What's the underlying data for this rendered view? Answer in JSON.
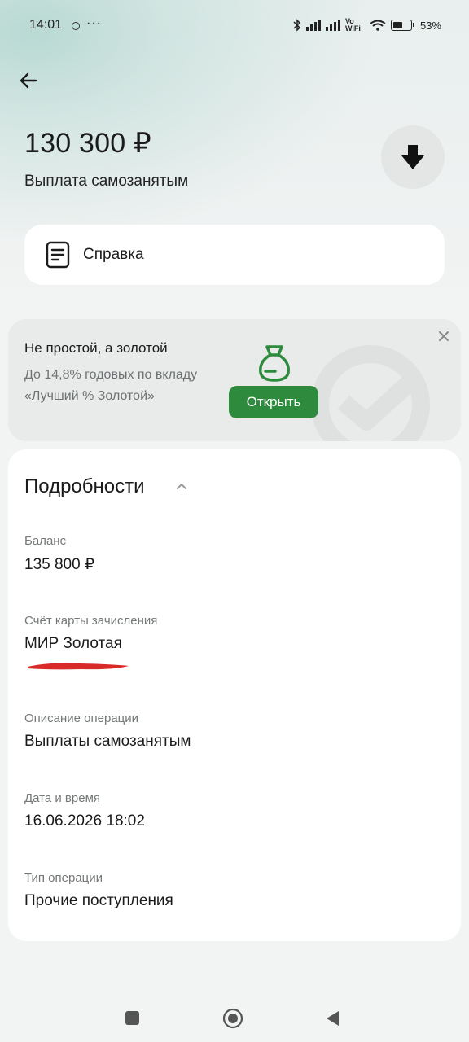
{
  "status_bar": {
    "time": "14:01",
    "dots": "···",
    "network": "Vo WiFi",
    "battery": "53%"
  },
  "header": {
    "amount": "130 300 ₽",
    "subtitle": "Выплата самозанятым"
  },
  "reference": {
    "label": "Справка"
  },
  "promo": {
    "title": "Не простой, а золотой",
    "text": "До 14,8% годовых по вкладу «Лучший % Золотой»",
    "button": "Открыть",
    "accent": "#2e8b3d"
  },
  "details": {
    "title": "Подробности",
    "fields": [
      {
        "label": "Баланс",
        "value": "135 800 ₽"
      },
      {
        "label": "Счёт карты зачисления",
        "value": "МИР Золотая"
      },
      {
        "label": "Описание операции",
        "value": "Выплаты самозанятым"
      },
      {
        "label": "Дата и время",
        "value": "16.06.2026 18:02"
      },
      {
        "label": "Тип операции",
        "value": "Прочие поступления"
      }
    ]
  },
  "icons": {
    "back": "arrow-left-icon",
    "download": "download-arrow-icon",
    "document": "document-icon",
    "close": "close-icon",
    "bag": "money-bag-icon",
    "chevron": "chevron-up-icon"
  }
}
